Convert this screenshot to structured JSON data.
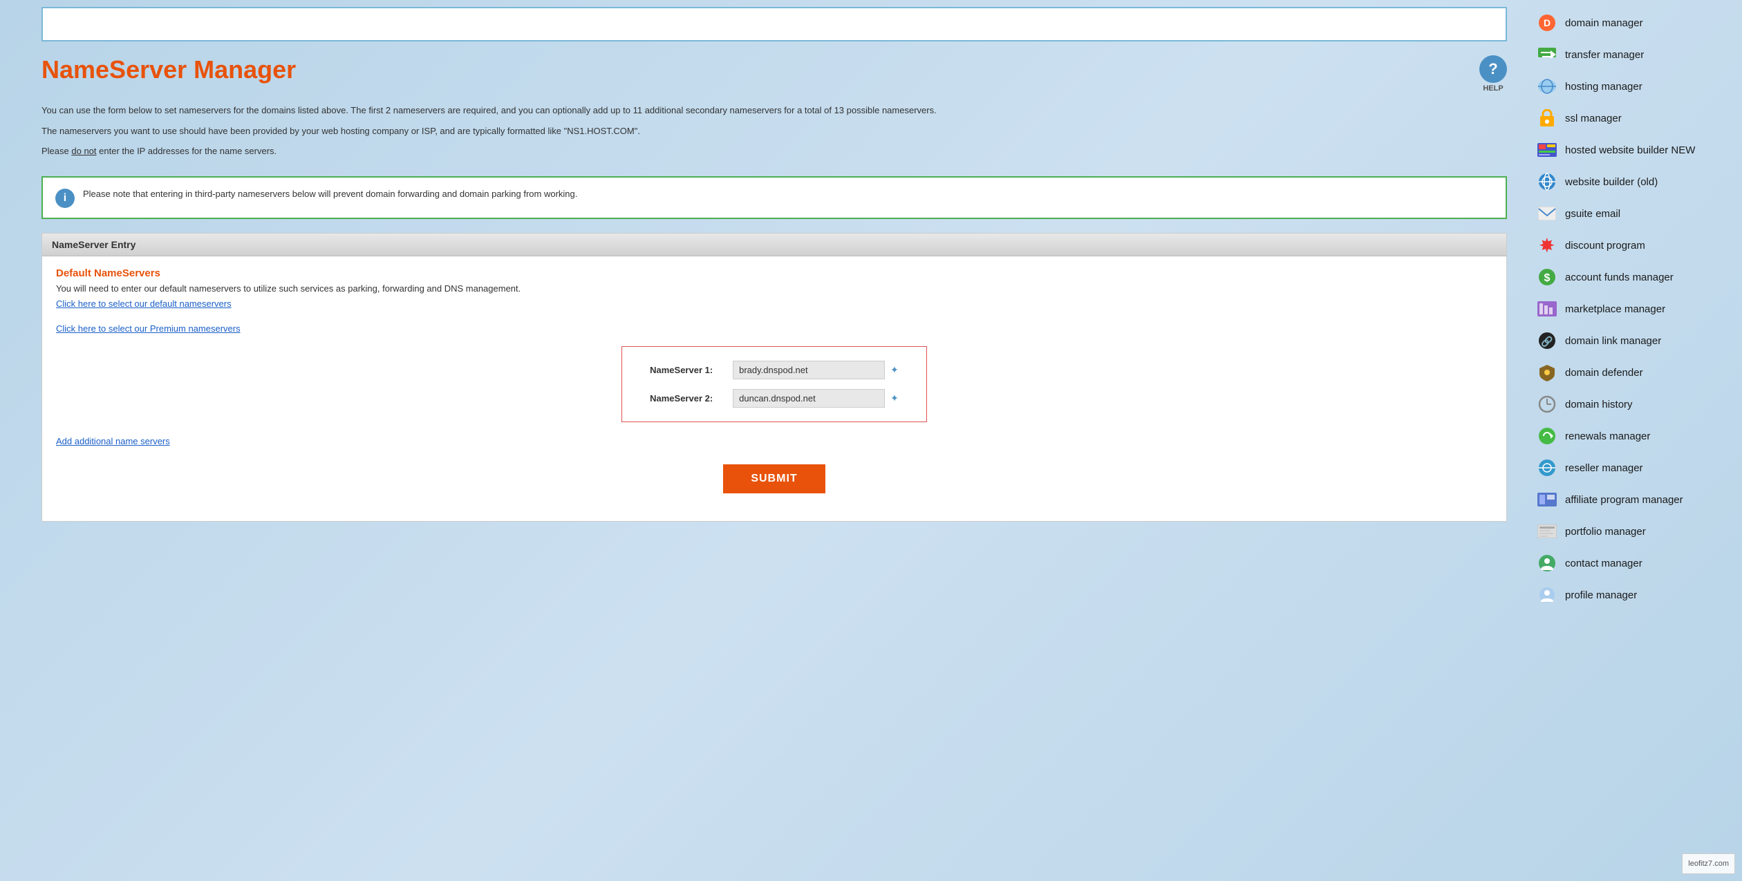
{
  "page": {
    "title": "NameServer Manager",
    "help_label": "HELP",
    "description1": "You can use the form below to set nameservers for the domains listed above. The first 2 nameservers are required, and you can optionally add up to 11 additional secondary nameservers for a total of 13 possible nameservers.",
    "description2": "The nameservers you want to use should have been provided by your web hosting company or ISP, and are typically formatted like \"NS1.HOST.COM\".",
    "description3_prefix": "Please ",
    "description3_underline": "do not",
    "description3_suffix": " enter the IP addresses for the name servers.",
    "info_text": "Please note that entering in third-party nameservers below will prevent domain forwarding and domain parking from working.",
    "ns_entry_header": "NameServer Entry",
    "default_ns_title": "Default NameServers",
    "default_ns_desc": "You will need to enter our default nameservers to utilize such services as parking, forwarding and DNS management.",
    "default_link": "Click here to select our default nameservers",
    "premium_link": "Click here to select our Premium nameservers",
    "ns1_label": "NameServer 1:",
    "ns1_value": "brady.dnspod.net",
    "ns2_label": "NameServer 2:",
    "ns2_value": "duncan.dnspod.net",
    "add_more_link": "Add additional name servers",
    "submit_label": "SUBMIT",
    "watermark": "leofitz7.com"
  },
  "sidebar": {
    "items": [
      {
        "id": "domain-manager",
        "label": "domain manager",
        "icon": "icon-domain-manager"
      },
      {
        "id": "transfer-manager",
        "label": "transfer manager",
        "icon": "icon-transfer"
      },
      {
        "id": "hosting-manager",
        "label": "hosting manager",
        "icon": "icon-hosting"
      },
      {
        "id": "ssl-manager",
        "label": "ssl manager",
        "icon": "icon-ssl"
      },
      {
        "id": "hosted-website-builder",
        "label": "hosted website builder NEW",
        "icon": "icon-website-builder"
      },
      {
        "id": "website-builder-old",
        "label": "website builder (old)",
        "icon": "icon-website-old"
      },
      {
        "id": "gsuite-email",
        "label": "gsuite email",
        "icon": "icon-gsuite"
      },
      {
        "id": "discount-program",
        "label": "discount program",
        "icon": "icon-discount"
      },
      {
        "id": "account-funds-manager",
        "label": "account funds manager",
        "icon": "icon-funds"
      },
      {
        "id": "marketplace-manager",
        "label": "marketplace manager",
        "icon": "icon-marketplace"
      },
      {
        "id": "domain-link-manager",
        "label": "domain link manager",
        "icon": "icon-domain-link"
      },
      {
        "id": "domain-defender",
        "label": "domain defender",
        "icon": "icon-domain-defender"
      },
      {
        "id": "domain-history",
        "label": "domain history",
        "icon": "icon-domain-history"
      },
      {
        "id": "renewals-manager",
        "label": "renewals manager",
        "icon": "icon-renewals"
      },
      {
        "id": "reseller-manager",
        "label": "reseller manager",
        "icon": "icon-reseller"
      },
      {
        "id": "affiliate-program-manager",
        "label": "affiliate program manager",
        "icon": "icon-affiliate"
      },
      {
        "id": "portfolio-manager",
        "label": "portfolio manager",
        "icon": "icon-portfolio"
      },
      {
        "id": "contact-manager",
        "label": "contact manager",
        "icon": "icon-contact"
      },
      {
        "id": "profile-manager",
        "label": "profile manager",
        "icon": "icon-profile"
      }
    ]
  }
}
